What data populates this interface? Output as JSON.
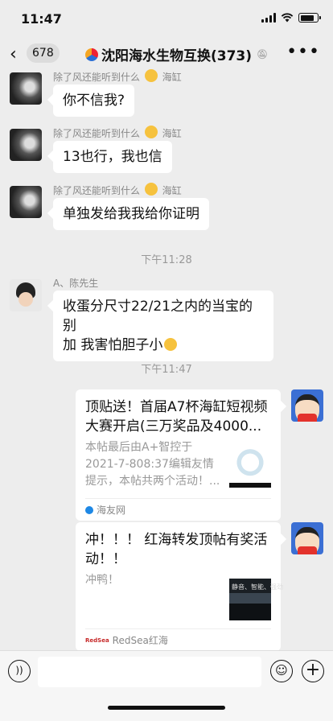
{
  "status_bar": {
    "time": "11:47"
  },
  "nav": {
    "back_icon": "chevron-left-icon",
    "unread_count": "678",
    "title": "沈阳海水生物互换(373)",
    "more_icon": "more-dots-icon"
  },
  "messages": [
    {
      "sender": "除了风还能听到什么",
      "sender_suffix": "海缸",
      "text": "你不信我?"
    },
    {
      "sender": "除了风还能听到什么",
      "sender_suffix": "海缸",
      "text": "13也行，我也信"
    },
    {
      "sender": "除了风还能听到什么",
      "sender_suffix": "海缸",
      "text": "单独发给我我给你证明"
    },
    {
      "sender": "A、陈先生",
      "text_line1": "收蛋分尺寸22/21之内的当宝的别",
      "text_line2": "加 我害怕胆子小"
    }
  ],
  "timestamps": [
    "下午11:28",
    "下午11:47"
  ],
  "cards": [
    {
      "title": "顶贴送！首届A7杯海缸短视频大赛开启(三万奖品及4000...",
      "description": "本帖最后由A+智控于2021-7-808:37编辑友情提示，本帖共两个活动！...",
      "source": "海友网"
    },
    {
      "title": "冲！！！ 红海转发顶帖有奖活动！！",
      "description": "冲鸭！",
      "thumb_caption": "静音、智能、强劲",
      "source_logo": "RedSea",
      "source": "RedSea红海"
    }
  ],
  "input_bar": {
    "voice_icon": "voice-icon",
    "emoji_icon": "emoji-icon",
    "plus_icon": "plus-icon"
  }
}
